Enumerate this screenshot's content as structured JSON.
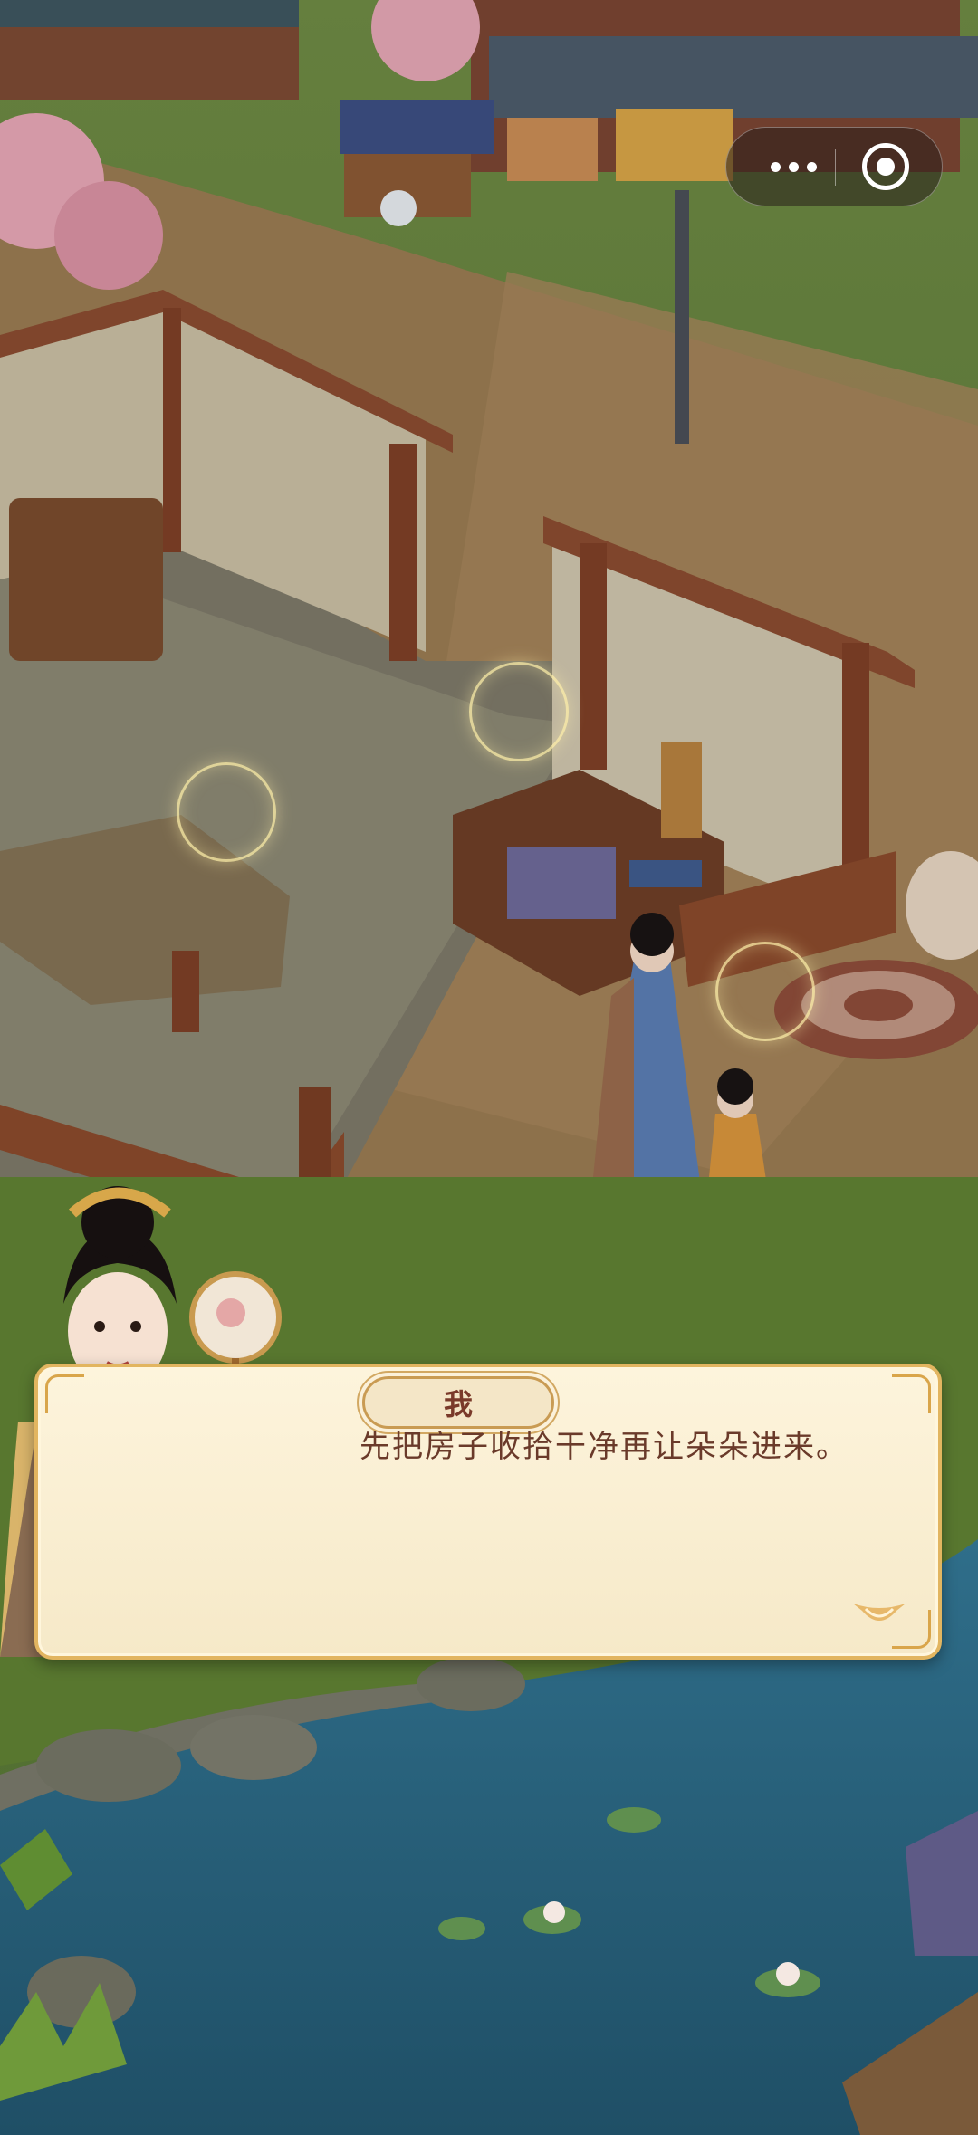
{
  "dialog": {
    "speaker": "我",
    "text": "先把房子收拾干净再让朵朵进来。"
  },
  "capsule": {
    "more_icon": "more-dots-icon",
    "close_icon": "target-close-icon"
  },
  "colors": {
    "dialog_bg": "#fdf4dc",
    "dialog_border": "#e2b560",
    "text": "#6a3a2a"
  }
}
